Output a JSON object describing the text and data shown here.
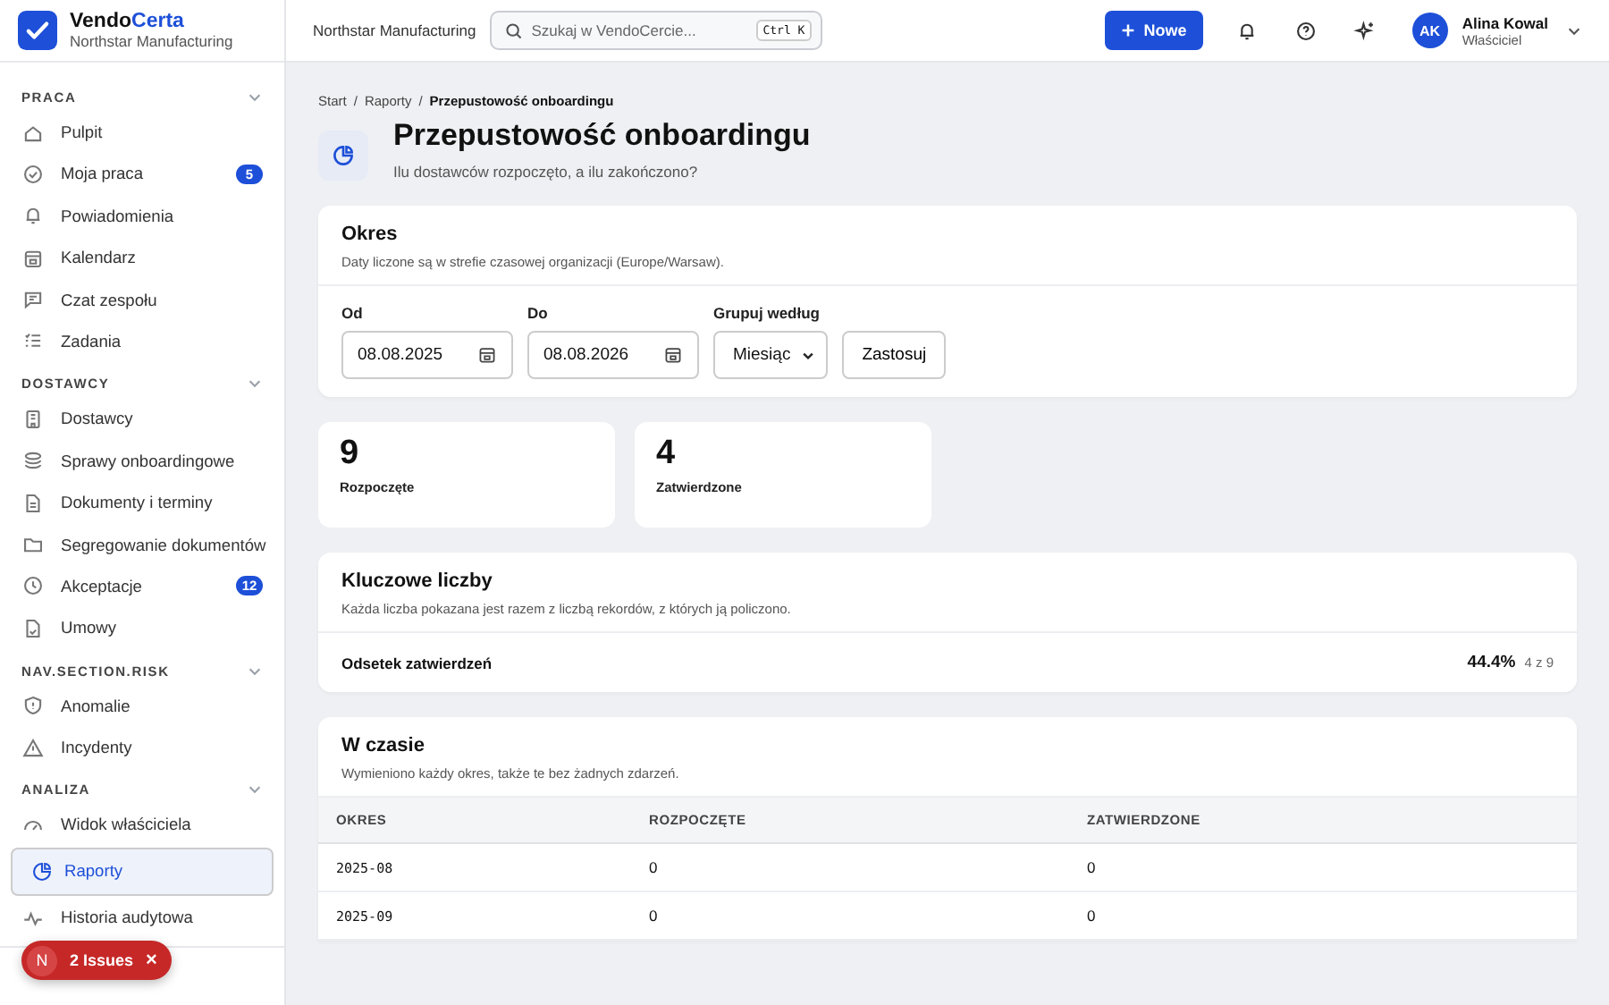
{
  "brand": {
    "name_part1": "Vendo",
    "name_part2": "Certa",
    "org": "Northstar Manufacturing"
  },
  "sidebar": {
    "sections": [
      {
        "title": "PRACA",
        "expanded": true,
        "items": [
          {
            "label": "Pulpit",
            "selected": false
          },
          {
            "label": "Moja praca",
            "selected": false,
            "badge": "5"
          },
          {
            "label": "Powiadomienia",
            "selected": false
          },
          {
            "label": "Kalendarz",
            "selected": false
          },
          {
            "label": "Czat zespołu",
            "selected": false
          },
          {
            "label": "Zadania",
            "selected": false
          }
        ]
      },
      {
        "title": "DOSTAWCY",
        "expanded": true,
        "items": [
          {
            "label": "Dostawcy",
            "selected": false
          },
          {
            "label": "Sprawy onboardingowe",
            "selected": false
          },
          {
            "label": "Dokumenty i terminy",
            "selected": false
          },
          {
            "label": "Segregowanie dokumentów",
            "selected": false
          },
          {
            "label": "Akceptacje",
            "selected": false,
            "badge": "12"
          },
          {
            "label": "Umowy",
            "selected": false
          }
        ]
      },
      {
        "title": "NAV.SECTION.RISK",
        "expanded": true,
        "items": [
          {
            "label": "Anomalie",
            "selected": false
          },
          {
            "label": "Incydenty",
            "selected": false
          }
        ]
      },
      {
        "title": "ANALIZA",
        "expanded": true,
        "items": [
          {
            "label": "Widok właściciela",
            "selected": false
          },
          {
            "label": "Raporty",
            "selected": true
          },
          {
            "label": "Historia audytowa",
            "selected": false
          }
        ]
      }
    ]
  },
  "issues_badge": {
    "letter": "N",
    "label": "2 Issues",
    "close": "×"
  },
  "topbar": {
    "org": "Northstar Manufacturing",
    "search": {
      "placeholder": "Szukaj w VendoCercie...",
      "shortcut": "Ctrl K"
    },
    "new_button": "Nowe",
    "user": {
      "initials": "AK",
      "name": "Alina Kowal",
      "role": "Właściciel"
    }
  },
  "breadcrumb": {
    "separator": "/",
    "items": [
      {
        "label": "Start",
        "current": false
      },
      {
        "label": "Raporty",
        "current": false
      },
      {
        "label": "Przepustowość onboardingu",
        "current": true
      }
    ]
  },
  "page": {
    "title": "Przepustowość onboardingu",
    "subtitle": "Ilu dostawców rozpoczęto, a ilu zakończono?"
  },
  "period": {
    "title": "Okres",
    "note": "Daty liczone są w strefie czasowej organizacji (Europe/Warsaw).",
    "from_label": "Od",
    "from": "08.08.2025",
    "to_label": "Do",
    "to": "08.08.2026",
    "group_label": "Grupuj według",
    "group": "Miesiąc",
    "apply": "Zastosuj"
  },
  "stats": [
    {
      "value": "9",
      "label": "Rozpoczęte"
    },
    {
      "value": "4",
      "label": "Zatwierdzone"
    }
  ],
  "key_figures": {
    "title": "Kluczowe liczby",
    "note": "Każda liczba pokazana jest razem z liczbą rekordów, z których ją policzono.",
    "rows": [
      {
        "label": "Odsetek zatwierdzeń",
        "value": "44.4%",
        "count": "4 z 9"
      }
    ]
  },
  "over_time": {
    "title": "W czasie",
    "note": "Wymieniono każdy okres, także te bez żadnych zdarzeń.",
    "columns": [
      "OKRES",
      "ROZPOCZĘTE",
      "ZATWIERDZONE"
    ],
    "rows": [
      [
        "2025-08",
        "0",
        "0"
      ],
      [
        "2025-09",
        "0",
        "0"
      ]
    ]
  }
}
